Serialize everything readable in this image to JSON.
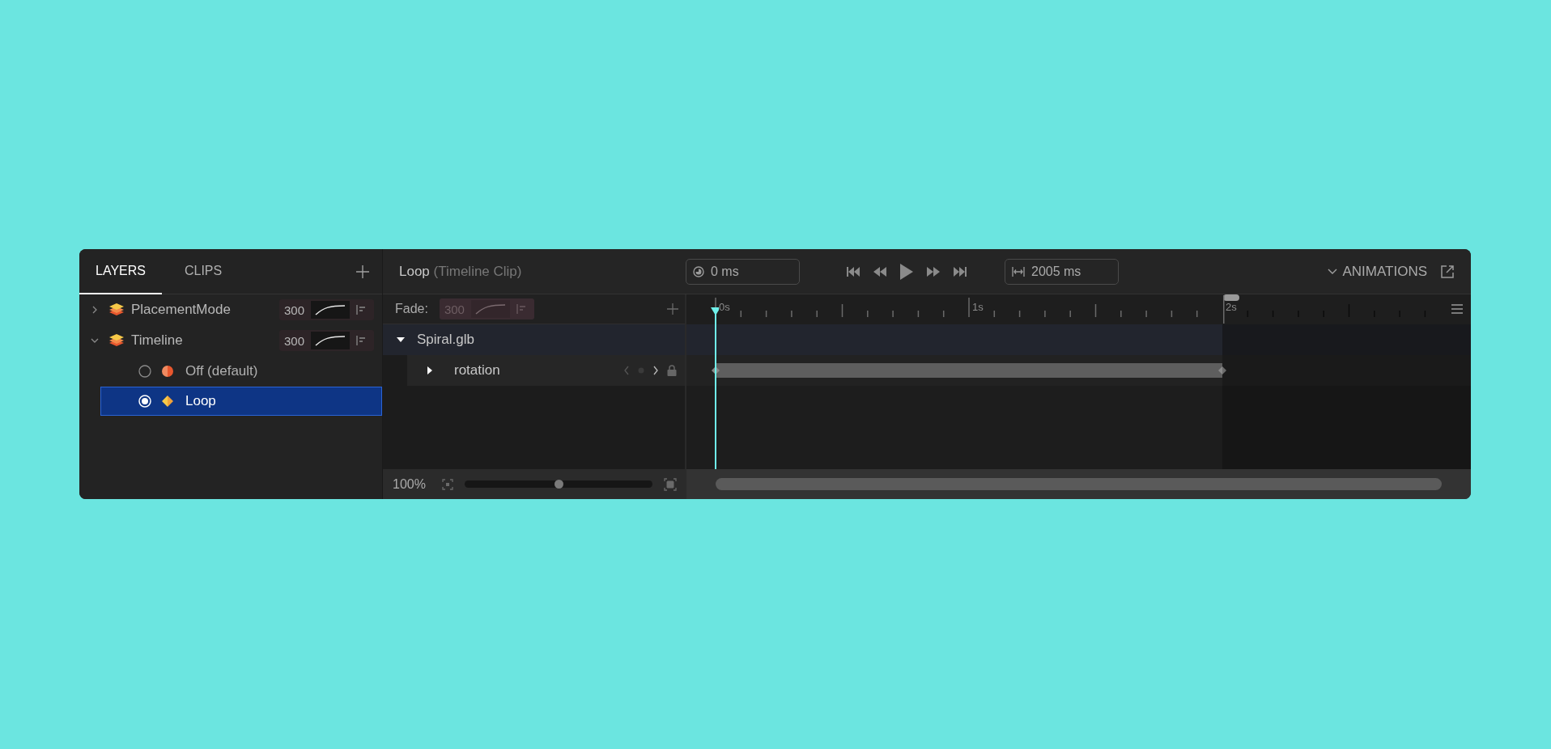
{
  "tabs": [
    {
      "label": "LAYERS",
      "selected": true
    },
    {
      "label": "CLIPS",
      "selected": false
    }
  ],
  "layers": [
    {
      "name": "PlacementMode",
      "expanded": false,
      "fade": "300"
    },
    {
      "name": "Timeline",
      "expanded": true,
      "fade": "300",
      "children": [
        {
          "name": "Off (default)",
          "kind": "half-circle",
          "selected": false
        },
        {
          "name": "Loop",
          "kind": "diamond",
          "selected": true
        }
      ]
    }
  ],
  "clip_header": {
    "title": "Loop",
    "subtitle": "(Timeline Clip)"
  },
  "time_field": {
    "value": "0 ms"
  },
  "duration_field": {
    "value": "2005 ms"
  },
  "animations_toggle": {
    "label": "ANIMATIONS"
  },
  "fade": {
    "label": "Fade:",
    "value": "300"
  },
  "tracks": [
    {
      "name": "Spiral.glb",
      "expanded": true,
      "children": [
        {
          "name": "rotation",
          "expanded": false
        }
      ]
    }
  ],
  "ruler": {
    "labels": [
      "0s",
      "1s",
      "2s"
    ]
  },
  "zoom": {
    "label": "100%",
    "level": 0.5
  }
}
